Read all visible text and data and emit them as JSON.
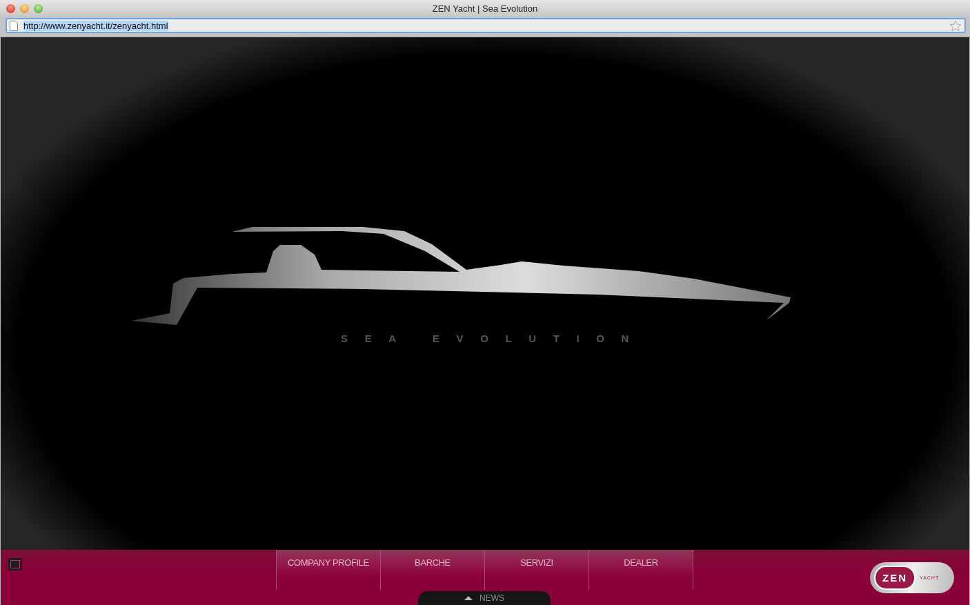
{
  "window": {
    "title": "ZEN Yacht | Sea Evolution"
  },
  "address_bar": {
    "url": "http://www.zenyacht.it/zenyacht.html",
    "selected": true
  },
  "hero": {
    "tagline": "SEA EVOLUTION"
  },
  "nav": [
    {
      "label": "COMPANY PROFILE"
    },
    {
      "label": "BARCHE"
    },
    {
      "label": "SERVIZI"
    },
    {
      "label": "DEALER"
    }
  ],
  "news_tab": {
    "label": "NEWS"
  },
  "logo": {
    "brand": "ZEN",
    "sub": "YACHT"
  }
}
